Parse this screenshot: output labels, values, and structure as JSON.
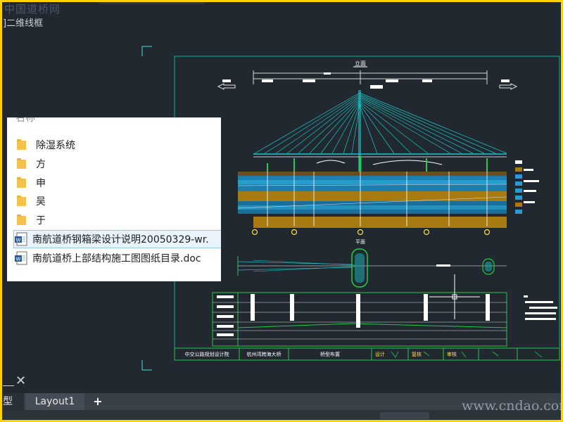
{
  "watermark_top": "中国道桥网",
  "viewport_label": "]二维线框",
  "file_panel": {
    "header": "名称",
    "items": [
      {
        "type": "folder",
        "name": "除湿系统"
      },
      {
        "type": "folder",
        "name": "方"
      },
      {
        "type": "folder",
        "name": "申"
      },
      {
        "type": "folder",
        "name": "吴"
      },
      {
        "type": "folder",
        "name": "于"
      },
      {
        "type": "doc",
        "name": "南航道桥钢箱梁设计说明20050329-wr."
      },
      {
        "type": "doc",
        "name": "南航道桥上部结构施工图图纸目录.doc"
      }
    ]
  },
  "drawing": {
    "elevation_label": "立面",
    "plan_label": "平面",
    "title_block": [
      "中交公路规划设计院",
      "杭州湾跨海大桥",
      "桥型布置",
      "设计",
      "复核",
      "审核"
    ]
  },
  "tabs": {
    "model": "型",
    "layout": "Layout1",
    "add": "+"
  },
  "close_symbol": "✕",
  "watermark_bottom": "www.cndao.com",
  "colors": {
    "background": "#212830",
    "frame": "#ffd400",
    "cable": "#19c8c8",
    "sheet_border": "#00c8a0",
    "soil_brown": "#b8860b",
    "water_blue": "#2aa0d8"
  }
}
